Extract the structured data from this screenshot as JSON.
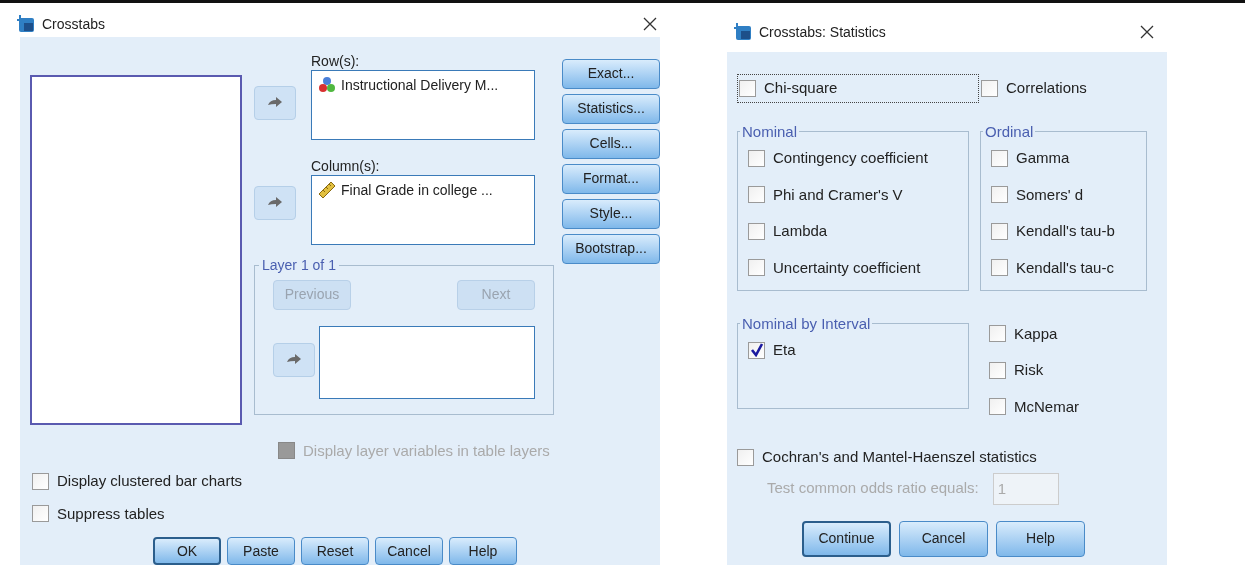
{
  "crosstabs": {
    "title": "Crosstabs",
    "row_label": "Row(s):",
    "row_items": [
      {
        "name": "Instructional Delivery M...",
        "kind": "nominal"
      }
    ],
    "column_label": "Column(s):",
    "column_items": [
      {
        "name": "Final Grade in college ...",
        "kind": "scale"
      }
    ],
    "side_buttons": [
      "Exact...",
      "Statistics...",
      "Cells...",
      "Format...",
      "Style...",
      "Bootstrap..."
    ],
    "layer": {
      "title": "Layer 1 of 1",
      "previous": {
        "label": "Previous",
        "disabled": true
      },
      "next": {
        "label": "Next",
        "disabled": true
      }
    },
    "display_layer": {
      "label": "Display layer variables in table layers",
      "checked": false,
      "disabled": true
    },
    "options": [
      {
        "label": "Display clustered bar charts",
        "checked": false
      },
      {
        "label": "Suppress tables",
        "checked": false
      }
    ],
    "buttons": [
      {
        "label": "OK",
        "default": true
      },
      {
        "label": "Paste",
        "default": false
      },
      {
        "label": "Reset",
        "default": false
      },
      {
        "label": "Cancel",
        "default": false
      },
      {
        "label": "Help",
        "default": false
      }
    ]
  },
  "statistics": {
    "title": "Crosstabs: Statistics",
    "top": [
      {
        "label": "Chi-square",
        "checked": false,
        "focused": true
      },
      {
        "label": "Correlations",
        "checked": false,
        "focused": false
      }
    ],
    "nominal": {
      "title": "Nominal",
      "items": [
        {
          "label": "Contingency coefficient",
          "checked": false
        },
        {
          "label": "Phi and Cramer's V",
          "checked": false
        },
        {
          "label": "Lambda",
          "checked": false
        },
        {
          "label": "Uncertainty coefficient",
          "checked": false
        }
      ]
    },
    "ordinal": {
      "title": "Ordinal",
      "items": [
        {
          "label": "Gamma",
          "checked": false
        },
        {
          "label": "Somers' d",
          "checked": false
        },
        {
          "label": "Kendall's tau-b",
          "checked": false
        },
        {
          "label": "Kendall's tau-c",
          "checked": false
        }
      ]
    },
    "nominal_by_interval": {
      "title": "Nominal by Interval",
      "items": [
        {
          "label": "Eta",
          "checked": true
        }
      ]
    },
    "other": [
      {
        "label": "Kappa",
        "checked": false
      },
      {
        "label": "Risk",
        "checked": false
      },
      {
        "label": "McNemar",
        "checked": false
      }
    ],
    "cochran": {
      "label": "Cochran's and Mantel-Haenszel statistics",
      "checked": false
    },
    "odds": {
      "label": "Test common odds ratio equals:",
      "value": "1",
      "disabled": true
    },
    "buttons": [
      {
        "label": "Continue",
        "default": true
      },
      {
        "label": "Cancel",
        "default": false
      },
      {
        "label": "Help",
        "default": false
      }
    ]
  }
}
